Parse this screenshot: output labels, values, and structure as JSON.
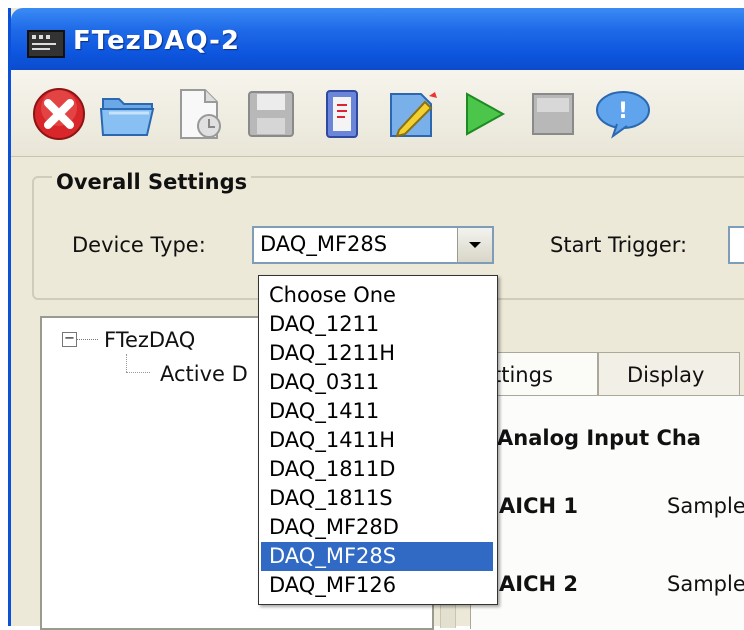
{
  "window": {
    "title": "FTezDAQ-2"
  },
  "toolbar": {
    "buttons": [
      {
        "icon": "close-red-icon"
      },
      {
        "icon": "open-folder-icon"
      },
      {
        "icon": "new-document-icon"
      },
      {
        "icon": "save-disk-icon"
      },
      {
        "icon": "notebook-icon"
      },
      {
        "icon": "edit-pen-icon"
      },
      {
        "icon": "play-icon"
      },
      {
        "icon": "stop-icon"
      },
      {
        "icon": "help-bubble-icon"
      }
    ]
  },
  "overall_settings": {
    "title": "Overall Settings",
    "device_type_label": "Device Type:",
    "device_type_value": "DAQ_MF28S",
    "start_trigger_label": "Start Trigger:"
  },
  "dropdown": {
    "options": [
      "Choose One",
      "DAQ_1211",
      "DAQ_1211H",
      "DAQ_0311",
      "DAQ_1411",
      "DAQ_1411H",
      "DAQ_1811D",
      "DAQ_1811S",
      "DAQ_MF28D",
      "DAQ_MF28S",
      "DAQ_MF126"
    ],
    "selected": "DAQ_MF28S"
  },
  "tree": {
    "root": "FTezDAQ",
    "child": "Active D"
  },
  "tabs": [
    {
      "label": "ttings"
    },
    {
      "label": "Display"
    }
  ],
  "panel": {
    "heading": "Analog Input Cha",
    "channels": [
      {
        "name": "AICH 1",
        "field": "Sample"
      },
      {
        "name": "AICH 2",
        "field": "Sample"
      }
    ]
  },
  "colors": {
    "titlebar": "#0d55de",
    "selection": "#316ac5",
    "window_bg": "#ece9d8"
  }
}
